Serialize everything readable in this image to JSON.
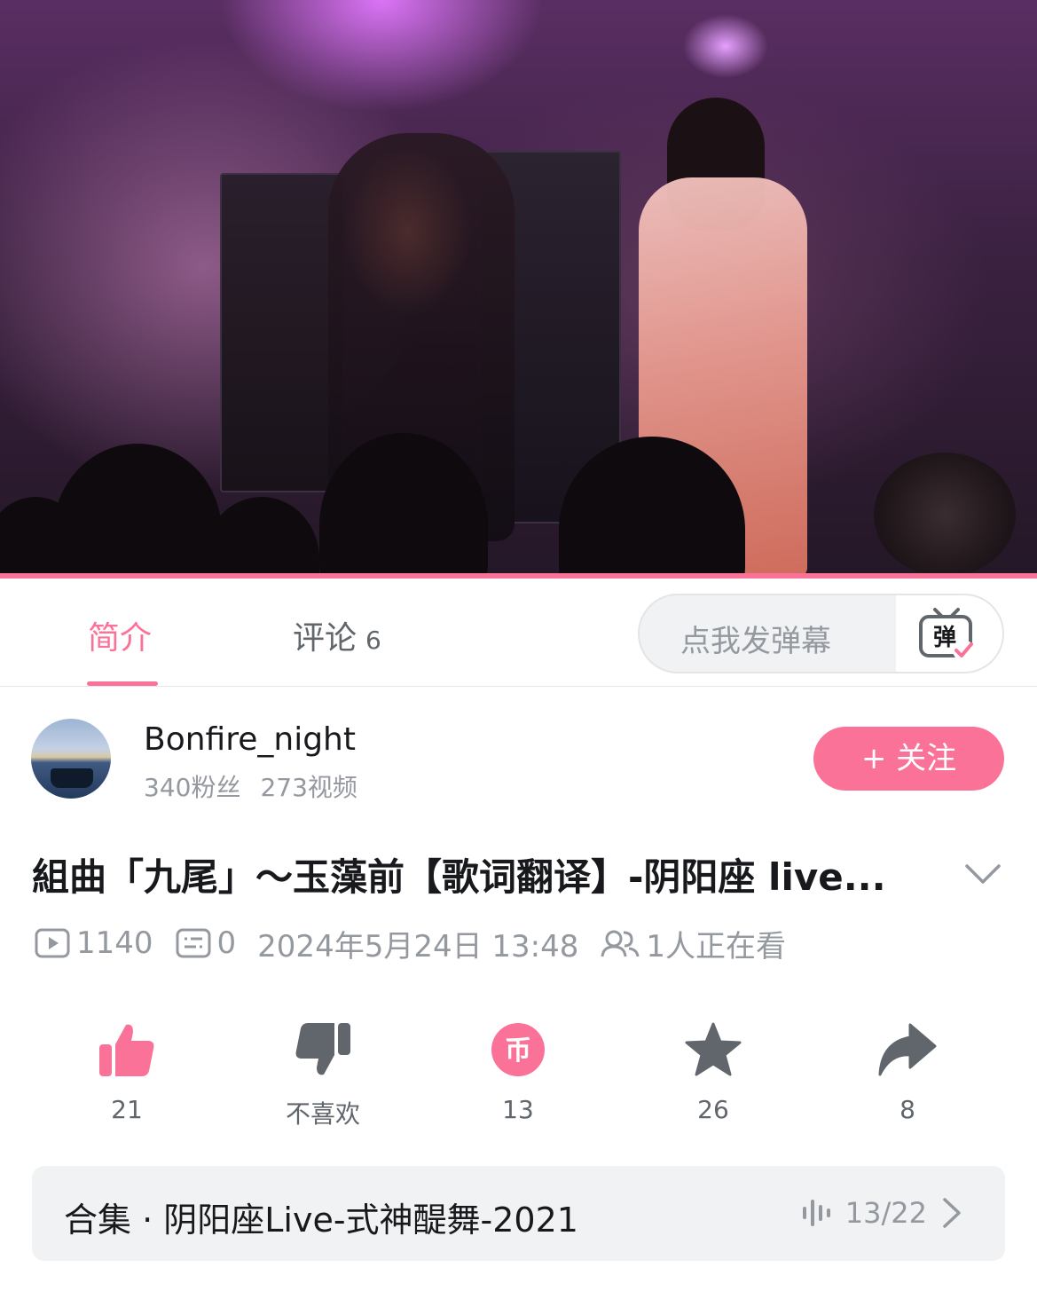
{
  "player": {
    "playback_progress": 1.0,
    "accent_color": "#fb7299"
  },
  "tabs": {
    "intro": "简介",
    "comments": "评论",
    "comment_count": "6"
  },
  "danmaku": {
    "placeholder": "点我发弹幕",
    "button_icon": "danmaku-toggle-icon",
    "button_glyph": "弹"
  },
  "uploader": {
    "name": "Bonfire_night",
    "followers": "340粉丝",
    "videos": "273视频",
    "follow_label": "+ 关注"
  },
  "video": {
    "title": "組曲「九尾」～玉藻前【歌词翻译】-阴阳座 live...",
    "views": "1140",
    "danmaku_count": "0",
    "date": "2024年5月24日 13:48",
    "watching": "1人正在看"
  },
  "actions": {
    "like": {
      "label": "21",
      "icon": "thumbs-up-icon",
      "color": "#fb7299"
    },
    "dislike": {
      "label": "不喜欢",
      "icon": "thumbs-down-icon",
      "color": "#61666d"
    },
    "coin": {
      "label": "13",
      "icon": "coin-icon",
      "color": "#fb7299",
      "glyph": "币"
    },
    "favorite": {
      "label": "26",
      "icon": "star-icon",
      "color": "#61666d"
    },
    "share": {
      "label": "8",
      "icon": "share-icon",
      "color": "#61666d"
    }
  },
  "collection": {
    "title": "合集 · 阴阳座Live-式神醍舞-2021",
    "progress": "13/22"
  }
}
